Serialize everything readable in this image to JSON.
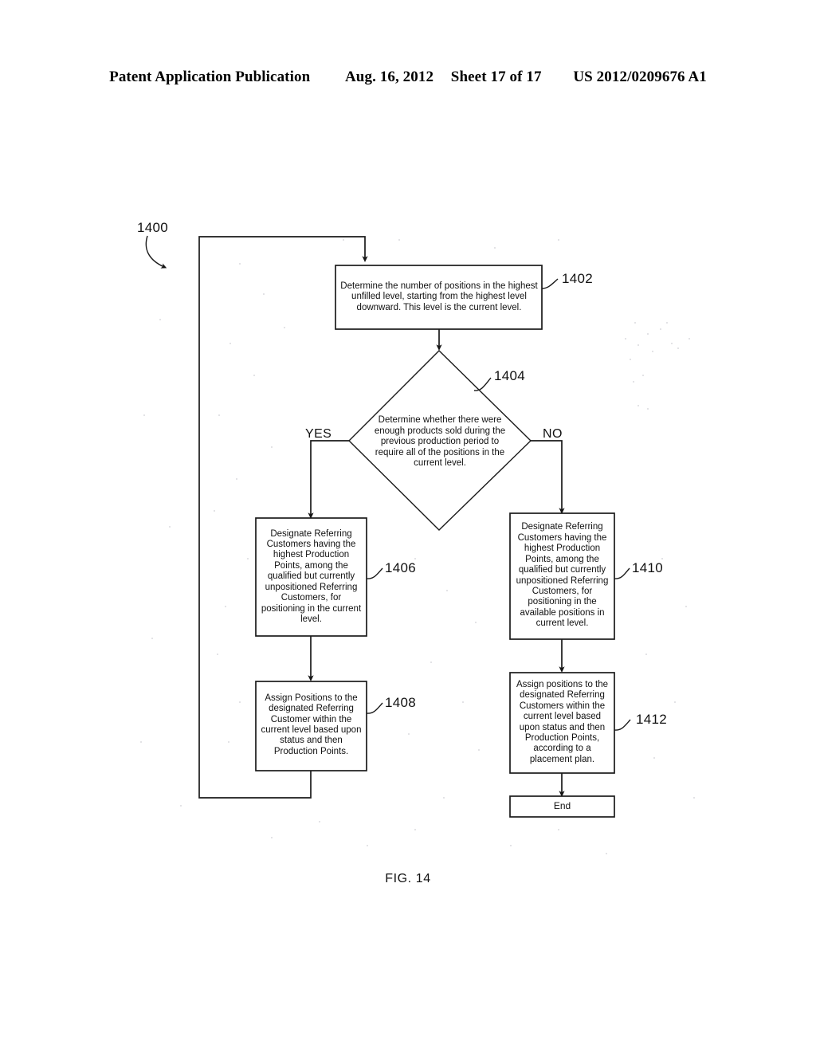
{
  "header": {
    "publication": "Patent Application Publication",
    "date": "Aug. 16, 2012",
    "sheet": "Sheet 17 of 17",
    "patent_number": "US 2012/0209676 A1"
  },
  "figure": {
    "caption": "FIG. 14",
    "diagram_label": "1400",
    "type": "flowchart"
  },
  "nodes": {
    "n1400": {
      "ref": "1400"
    },
    "n1402": {
      "ref": "1402",
      "shape": "rectangle",
      "text": "Determine the number of positions in the highest unfilled level, starting from the highest level downward. This level is the current level."
    },
    "n1404": {
      "ref": "1404",
      "shape": "diamond",
      "text": "Determine whether there were enough products sold during the previous production period to require all of the positions in the current level."
    },
    "n1406": {
      "ref": "1406",
      "shape": "rectangle",
      "text": "Designate Referring Customers having the highest Production Points, among the qualified but currently unpositioned Referring Customers, for positioning in the current level."
    },
    "n1408": {
      "ref": "1408",
      "shape": "rectangle",
      "text": "Assign Positions to the designated Referring Customer within the current level based upon status and then Production Points."
    },
    "n1410": {
      "ref": "1410",
      "shape": "rectangle",
      "text": "Designate Referring Customers having the highest Production Points, among the qualified but currently unpositioned Referring Customers, for positioning in the available positions in current level."
    },
    "n1412": {
      "ref": "1412",
      "shape": "rectangle",
      "text": "Assign positions to the designated Referring Customers within the current level based upon status and then Production Points, according to a placement plan."
    },
    "nEnd": {
      "shape": "rectangle",
      "text": "End"
    }
  },
  "branches": {
    "yes_label": "YES",
    "no_label": "NO"
  },
  "colors": {
    "ink": "#111111",
    "paper": "#ffffff",
    "line": "#1a1a1a"
  }
}
